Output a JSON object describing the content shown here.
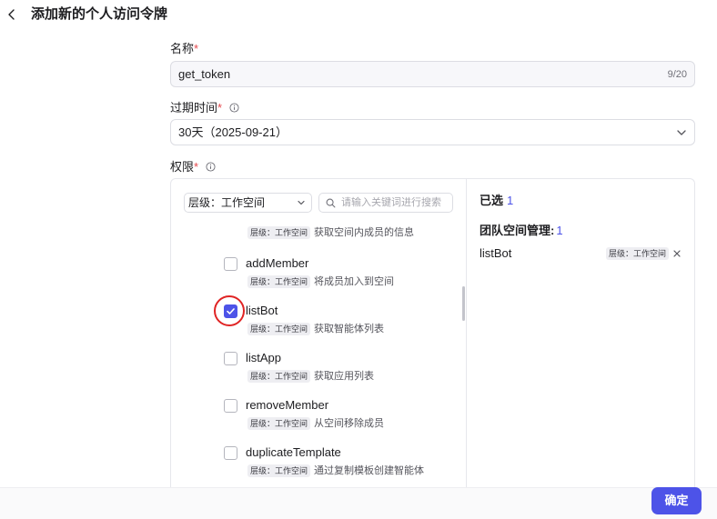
{
  "header": {
    "title": "添加新的个人访问令牌",
    "back_icon": "chevron-left-icon"
  },
  "name_field": {
    "label": "名称",
    "required_mark": "*",
    "value": "get_token",
    "counter": "9/20"
  },
  "expiry_field": {
    "label": "过期时间",
    "required_mark": "*",
    "value": "30天（2025-09-21）"
  },
  "permissions": {
    "label": "权限",
    "required_mark": "*",
    "level_select": {
      "value": "层级：工作空间"
    },
    "search": {
      "placeholder": "请输入关键词进行搜索"
    },
    "items": [
      {
        "name": "",
        "tag": "层级：工作空间",
        "desc": "获取空间内成员的信息",
        "checked": false
      },
      {
        "name": "addMember",
        "tag": "层级：工作空间",
        "desc": "将成员加入到空间",
        "checked": false
      },
      {
        "name": "listBot",
        "tag": "层级：工作空间",
        "desc": "获取智能体列表",
        "checked": true
      },
      {
        "name": "listApp",
        "tag": "层级：工作空间",
        "desc": "获取应用列表",
        "checked": false
      },
      {
        "name": "removeMember",
        "tag": "层级：工作空间",
        "desc": "从空间移除成员",
        "checked": false
      },
      {
        "name": "duplicateTemplate",
        "tag": "层级：工作空间",
        "desc": "通过复制模板创建智能体",
        "checked": false
      }
    ],
    "selected": {
      "label": "已选",
      "count": "1",
      "group_label": "团队空间管理:",
      "group_count": "1",
      "item": {
        "name": "listBot",
        "tag": "层级：工作空间"
      }
    }
  },
  "footer": {
    "confirm_label": "确定"
  },
  "colors": {
    "accent": "#4d53e8",
    "required": "#e5484d",
    "highlight": "#e02424"
  }
}
